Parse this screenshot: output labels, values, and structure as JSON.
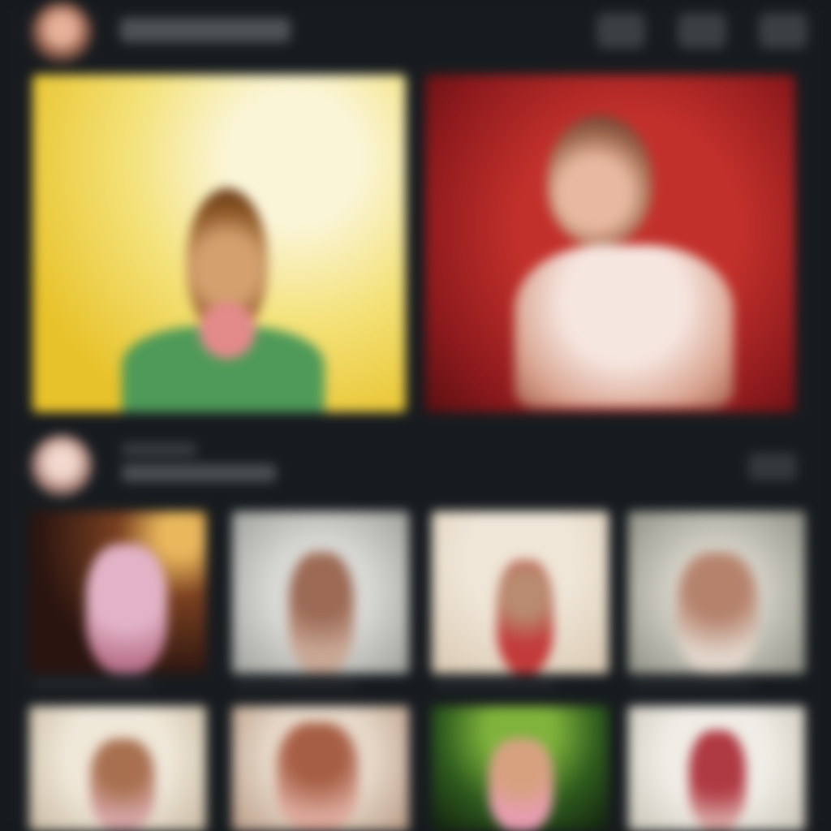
{
  "colors": {
    "background": "#171b1f",
    "surface": "#3b3f43",
    "feature_left": "#e8c22a",
    "feature_right": "#c2302b"
  },
  "header": {
    "title": "",
    "icons": [
      "action-icon",
      "action-icon",
      "action-icon"
    ]
  },
  "featured": [
    {
      "name": "featured-card",
      "accent": "#e8c22a"
    },
    {
      "name": "featured-card",
      "accent": "#c2302b"
    }
  ],
  "section": {
    "title": "",
    "subtitle": ""
  },
  "grid": [
    {
      "accent": "#2a1410"
    },
    {
      "accent": "#b9bab5"
    },
    {
      "accent": "#e8dfd2"
    },
    {
      "accent": "#a9aaa0"
    },
    {
      "accent": "#d8d3c6"
    },
    {
      "accent": "#c9b5a4"
    },
    {
      "accent": "#2d5a1d"
    },
    {
      "accent": "#dcd8d0"
    }
  ]
}
